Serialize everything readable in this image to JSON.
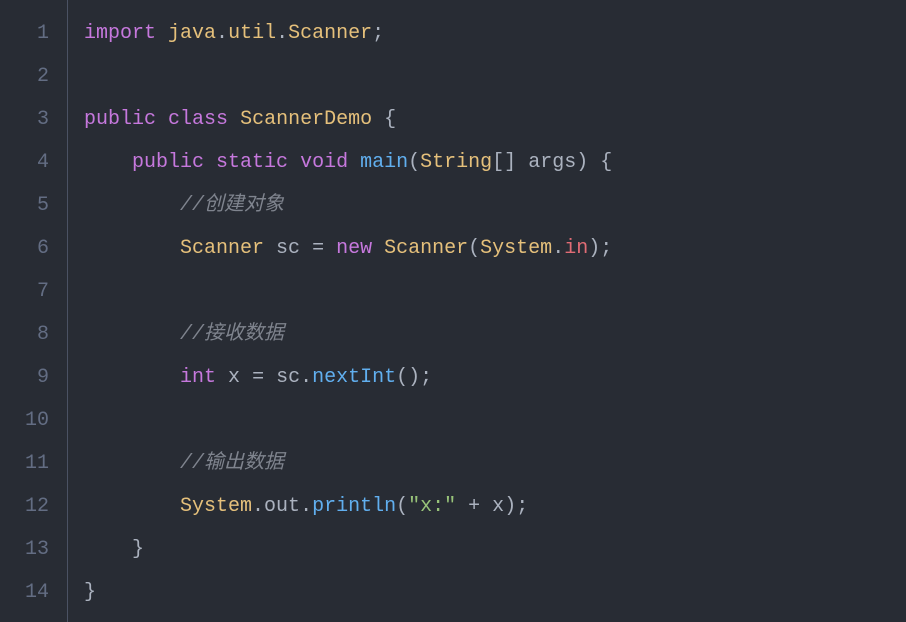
{
  "lineNumbers": [
    "1",
    "2",
    "3",
    "4",
    "5",
    "6",
    "7",
    "8",
    "9",
    "10",
    "11",
    "12",
    "13",
    "14"
  ],
  "code": {
    "line1": {
      "import": "import",
      "ns1": "java",
      "dot1": ".",
      "ns2": "util",
      "dot2": ".",
      "cls": "Scanner",
      "semi": ";"
    },
    "line3": {
      "public": "public",
      "class": "class",
      "name": "ScannerDemo",
      "brace": "{"
    },
    "line4": {
      "public": "public",
      "static": "static",
      "void": "void",
      "main": "main",
      "lparen": "(",
      "type": "String",
      "brackets": "[]",
      "arg": "args",
      "rparen": ")",
      "brace": "{"
    },
    "line5": {
      "comment": "//创建对象"
    },
    "line6": {
      "type": "Scanner",
      "var": "sc",
      "eq": "=",
      "new": "new",
      "ctor": "Scanner",
      "lparen": "(",
      "sys": "System",
      "dot": ".",
      "in": "in",
      "rparen": ")",
      "semi": ";"
    },
    "line8": {
      "comment": "//接收数据"
    },
    "line9": {
      "type": "int",
      "var": "x",
      "eq": "=",
      "obj": "sc",
      "dot": ".",
      "method": "nextInt",
      "parens": "()",
      "semi": ";"
    },
    "line11": {
      "comment": "//输出数据"
    },
    "line12": {
      "sys": "System",
      "dot1": ".",
      "out": "out",
      "dot2": ".",
      "method": "println",
      "lparen": "(",
      "str": "\"x:\"",
      "plus": "+",
      "var": "x",
      "rparen": ")",
      "semi": ";"
    },
    "line13": {
      "brace": "}"
    },
    "line14": {
      "brace": "}"
    }
  }
}
